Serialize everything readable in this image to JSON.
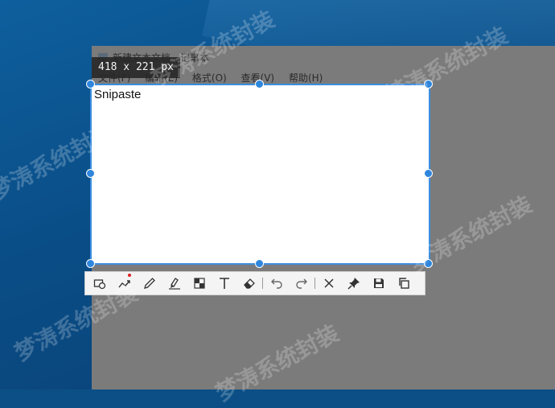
{
  "notepad": {
    "title": "新建文本文档 - 记事本",
    "menu": [
      "文件(F)",
      "编辑(E)",
      "格式(O)",
      "查看(V)",
      "帮助(H)"
    ]
  },
  "selection": {
    "size_label": "418 x 221 px",
    "content_text": "Snipaste"
  },
  "toolbar": {
    "tools": [
      {
        "name": "rectangle-tool-button",
        "icon": "shapes-icon"
      },
      {
        "name": "pen-tool-button",
        "icon": "polyline-icon",
        "has_badge": true
      },
      {
        "name": "pencil-tool-button",
        "icon": "pencil-icon"
      },
      {
        "name": "marker-tool-button",
        "icon": "marker-icon"
      },
      {
        "name": "mosaic-tool-button",
        "icon": "mosaic-icon"
      },
      {
        "name": "text-tool-button",
        "icon": "text-icon"
      },
      {
        "name": "eraser-tool-button",
        "icon": "eraser-icon"
      },
      {
        "name": "undo-button",
        "icon": "undo-icon"
      },
      {
        "name": "redo-button",
        "icon": "redo-icon"
      },
      {
        "name": "cancel-button",
        "icon": "close-icon"
      },
      {
        "name": "pin-button",
        "icon": "pin-icon"
      },
      {
        "name": "save-button",
        "icon": "save-icon"
      },
      {
        "name": "copy-button",
        "icon": "copy-icon"
      }
    ]
  },
  "watermark_text": "梦涛系统封装",
  "colors": {
    "accent": "#3b8ee0",
    "badge": "#e02020"
  }
}
